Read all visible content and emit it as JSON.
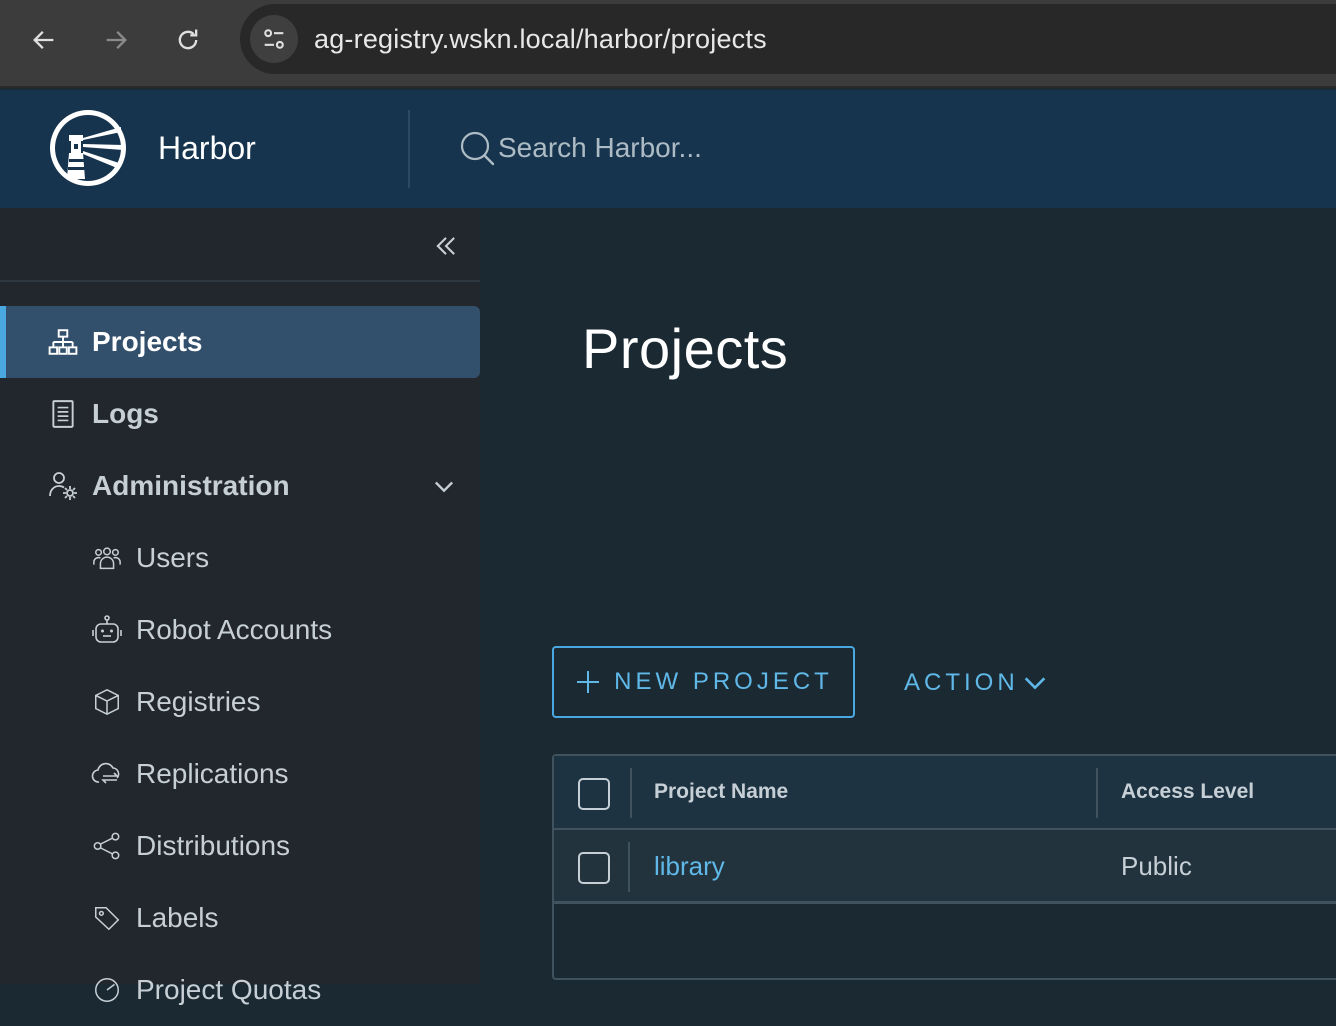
{
  "browser": {
    "url": "ag-registry.wskn.local/harbor/projects"
  },
  "header": {
    "brand": "Harbor",
    "search_placeholder": "Search Harbor..."
  },
  "sidebar": {
    "items": [
      {
        "label": "Projects",
        "icon": "projects-icon",
        "active": true
      },
      {
        "label": "Logs",
        "icon": "logs-icon"
      },
      {
        "label": "Administration",
        "icon": "administration-icon",
        "expanded": true
      }
    ],
    "admin_items": [
      {
        "label": "Users",
        "icon": "users-icon"
      },
      {
        "label": "Robot Accounts",
        "icon": "robot-icon"
      },
      {
        "label": "Registries",
        "icon": "registries-icon"
      },
      {
        "label": "Replications",
        "icon": "replications-icon"
      },
      {
        "label": "Distributions",
        "icon": "distributions-icon"
      },
      {
        "label": "Labels",
        "icon": "labels-icon"
      },
      {
        "label": "Project Quotas",
        "icon": "quotas-icon"
      }
    ]
  },
  "main": {
    "title": "Projects",
    "new_project_label": "NEW PROJECT",
    "action_label": "ACTION",
    "table": {
      "columns": [
        "Project Name",
        "Access Level"
      ],
      "rows": [
        {
          "name": "library",
          "access": "Public"
        }
      ]
    }
  },
  "colors": {
    "header_bg": "#17344e",
    "sidebar_bg": "#21272c",
    "main_bg": "#1b2a32",
    "accent": "#4aa8e0",
    "active_item_bg": "#324f6c"
  }
}
